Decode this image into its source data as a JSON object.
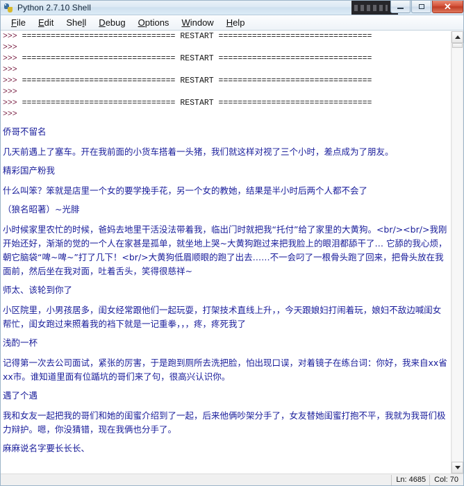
{
  "window": {
    "title": "Python 2.7.10 Shell",
    "icon": "python-logo-icon",
    "minimize_label": "",
    "maximize_label": "",
    "close_label": "✕"
  },
  "menubar": {
    "items": [
      {
        "label": "File",
        "accel": "F",
        "rest": "ile"
      },
      {
        "label": "Edit",
        "accel": "E",
        "rest": "dit"
      },
      {
        "label": "Shell",
        "accel": "l",
        "pre": "She",
        "rest": "l"
      },
      {
        "label": "Debug",
        "accel": "D",
        "rest": "ebug"
      },
      {
        "label": "Options",
        "accel": "O",
        "rest": "ptions"
      },
      {
        "label": "Window",
        "accel": "W",
        "rest": "indow"
      },
      {
        "label": "Help",
        "accel": "H",
        "rest": "elp"
      }
    ]
  },
  "shell": {
    "prompt": ">>> ",
    "restart_line": "================================ RESTART ================================",
    "restart_count": 4,
    "lines": [
      {
        "type": "restart",
        "prompt": ">>> ",
        "text": "================================ RESTART ================================"
      },
      {
        "type": "prompt",
        "prompt": ">>> ",
        "text": ""
      },
      {
        "type": "restart",
        "prompt": ">>> ",
        "text": "================================ RESTART ================================"
      },
      {
        "type": "prompt",
        "prompt": ">>> ",
        "text": ""
      },
      {
        "type": "restart",
        "prompt": ">>> ",
        "text": "================================ RESTART ================================"
      },
      {
        "type": "prompt",
        "prompt": ">>> ",
        "text": ""
      },
      {
        "type": "restart",
        "prompt": ">>> ",
        "text": "================================ RESTART ================================"
      },
      {
        "type": "prompt",
        "prompt": ">>> ",
        "text": ""
      }
    ],
    "posts": [
      {
        "title": "侨哥不留名",
        "body": "几天前遇上了塞车。开在我前面的小货车搭着一头猪，我们就这样对视了三个小时，差点成为了朋友。"
      },
      {
        "title": "精彩国产粉我",
        "body": "什么叫笨？笨就是店里一个女的要学挽手花，另一个女的教她，结果是半小时后两个人都不会了"
      },
      {
        "title": "（狼名昭著）~光腓",
        "body": "小时候家里农忙的时候，爸妈去地里干活没法带着我，临出门时就把我“托付”给了家里的大黄狗。<br/><br/>我刚开始还好，渐渐的觉的一个人在家甚是孤单，就坐地上哭~大黄狗跑过来把我脸上的眼泪都舔干了… 它舔的我心烦，朝它脑袋“啤~啤~”打了几下！<br/>大黄狗低眉顺眼的跑了出去……不一会叼了一根骨头跑了回来，把骨头放在我面前，然后坐在我对面，吐着舌头，笑得很慈祥~"
      },
      {
        "title": "师太、该轮到你了",
        "body": "小区院里，小男孩居多，闺女经常跟他们一起玩耍，打架技术直线上升，，今天跟娘妇打闹着玩，娘妇不敌边喊闺女帮忙，闺女跑过来照着我的裆下就是一记重拳，，，疼，疼死我了"
      },
      {
        "title": "浅酌一杯",
        "body": "记得第一次去公司面试，紧张的厉害，于是跑到厕所去洗把脸，怕出现口误，对着镜子在练台词：你好，我来自xx省xx市。谁知道里面有位踲坑的哥们来了句，很高兴认识你。"
      },
      {
        "title": "遇了个遇",
        "body": "我和女友一起把我的哥们和她的闺蜜介绍到了一起，后来他俩吵架分手了，女友替她闺蜜打抱不平，我就为我哥们极力辩护。嗯，你没猜错，现在我俩也分手了。"
      },
      {
        "title": "麻麻说名字要长长长、",
        "body": ""
      }
    ]
  },
  "scrollbar": {
    "up_arrow": "scroll-up-arrow",
    "down_arrow": "scroll-down-arrow",
    "thumb_position_pct": 0
  },
  "statusbar": {
    "line": "Ln: 4685",
    "col": "Col: 70"
  },
  "colors": {
    "prompt": "#7b2346",
    "chinese_text": "#181c9a",
    "restart_text": "#111111",
    "background": "#ffffff",
    "titlebar_close": "#c03b24"
  }
}
